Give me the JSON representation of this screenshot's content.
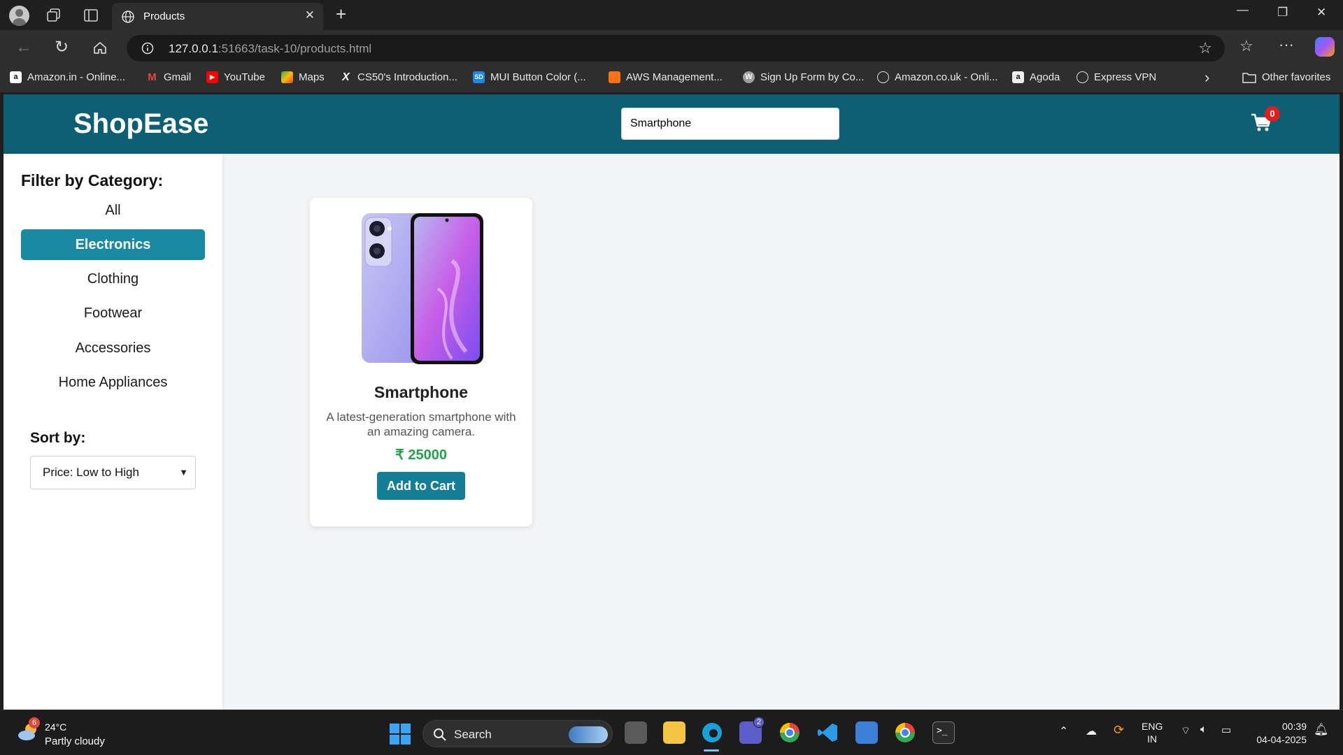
{
  "browser": {
    "tab_title": "Products",
    "url_host": "127.0.0.1",
    "url_path": ":51663/task-10/products.html",
    "bookmarks": [
      {
        "label": "Amazon.in - Online...",
        "icon": "amazon-icon"
      },
      {
        "label": "Gmail",
        "icon": "gmail-icon"
      },
      {
        "label": "YouTube",
        "icon": "youtube-icon"
      },
      {
        "label": "Maps",
        "icon": "maps-icon"
      },
      {
        "label": "CS50's Introduction...",
        "icon": "x-icon"
      },
      {
        "label": "MUI Button Color (...",
        "icon": "sd-icon"
      },
      {
        "label": "AWS Management...",
        "icon": "aws-icon"
      },
      {
        "label": "Sign Up Form by Co...",
        "icon": "wordpress-icon"
      },
      {
        "label": "Amazon.co.uk - Onli...",
        "icon": "globe-icon"
      },
      {
        "label": "Agoda",
        "icon": "agoda-icon"
      },
      {
        "label": "Express VPN",
        "icon": "globe-icon"
      }
    ],
    "other_favorites": "Other favorites"
  },
  "site": {
    "logo": "ShopEase",
    "search_value": "Smartphone",
    "cart_count": "0"
  },
  "sidebar": {
    "filter_title": "Filter by Category:",
    "categories": [
      "All",
      "Electronics",
      "Clothing",
      "Footwear",
      "Accessories",
      "Home Appliances"
    ],
    "active_category": "Electronics",
    "sort_label": "Sort by:",
    "sort_value": "Price: Low to High"
  },
  "product": {
    "name": "Smartphone",
    "description": "A latest-generation smartphone with an amazing camera.",
    "price": "₹ 25000",
    "add_label": "Add to Cart"
  },
  "taskbar": {
    "weather_badge": "6",
    "weather_temp": "24°C",
    "weather_desc": "Partly cloudy",
    "search_label": "Search",
    "teams_badge": "2",
    "lang_top": "ENG",
    "lang_bottom": "IN",
    "time": "00:39",
    "date": "04-04-2025"
  },
  "colors": {
    "header": "#0d5f73",
    "active_category": "#1a8aa3",
    "button": "#147e96",
    "price": "#22a34a",
    "badge": "#e11d1d"
  }
}
